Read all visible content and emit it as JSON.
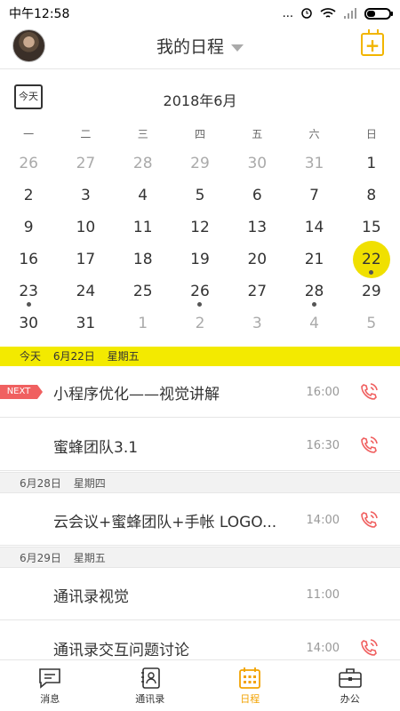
{
  "status": {
    "time": "中午12:58",
    "signal_text": "...",
    "battery_level": 0.35
  },
  "header": {
    "title": "我的日程"
  },
  "calendar": {
    "today_label": "今天",
    "month": "2018年6月",
    "weekdays": [
      "一",
      "二",
      "三",
      "四",
      "五",
      "六",
      "日"
    ],
    "rows": [
      [
        {
          "d": "26",
          "m": true
        },
        {
          "d": "27",
          "m": true
        },
        {
          "d": "28",
          "m": true
        },
        {
          "d": "29",
          "m": true
        },
        {
          "d": "30",
          "m": true
        },
        {
          "d": "31",
          "m": true
        },
        {
          "d": "1"
        }
      ],
      [
        {
          "d": "2"
        },
        {
          "d": "3"
        },
        {
          "d": "4"
        },
        {
          "d": "5"
        },
        {
          "d": "6"
        },
        {
          "d": "7"
        },
        {
          "d": "8"
        }
      ],
      [
        {
          "d": "9"
        },
        {
          "d": "10"
        },
        {
          "d": "11"
        },
        {
          "d": "12"
        },
        {
          "d": "13"
        },
        {
          "d": "14"
        },
        {
          "d": "15"
        }
      ],
      [
        {
          "d": "16"
        },
        {
          "d": "17"
        },
        {
          "d": "18"
        },
        {
          "d": "19"
        },
        {
          "d": "20"
        },
        {
          "d": "21"
        },
        {
          "d": "22",
          "sel": true,
          "dot": true
        }
      ],
      [
        {
          "d": "23",
          "dot": true
        },
        {
          "d": "24"
        },
        {
          "d": "25"
        },
        {
          "d": "26",
          "dot": true
        },
        {
          "d": "27"
        },
        {
          "d": "28",
          "dot": true
        },
        {
          "d": "29"
        }
      ],
      [
        {
          "d": "30"
        },
        {
          "d": "31"
        },
        {
          "d": "1",
          "m": true
        },
        {
          "d": "2",
          "m": true
        },
        {
          "d": "3",
          "m": true
        },
        {
          "d": "4",
          "m": true
        },
        {
          "d": "5",
          "m": true
        }
      ]
    ]
  },
  "agenda": {
    "today_bar": {
      "label": "今天",
      "date": "6月22日",
      "weekday": "星期五"
    },
    "next_badge": "NEXT",
    "items": [
      {
        "title": "小程序优化——视觉讲解",
        "time": "16:00",
        "phone": true
      },
      {
        "title": "蜜蜂团队3.1",
        "time": "16:30",
        "phone": true
      },
      {
        "title": "云会议+蜜蜂团队+手帐 LOGO...",
        "time": "14:00",
        "phone": true
      },
      {
        "title": "通讯录视觉",
        "time": "11:00",
        "phone": false
      },
      {
        "title": "通讯录交互问题讨论",
        "time": "14:00",
        "phone": true
      }
    ],
    "sections": [
      {
        "date": "6月28日",
        "weekday": "星期四"
      },
      {
        "date": "6月29日",
        "weekday": "星期五"
      }
    ]
  },
  "nav": {
    "tabs": [
      {
        "label": "消息",
        "icon": "message-icon"
      },
      {
        "label": "通讯录",
        "icon": "contacts-icon"
      },
      {
        "label": "日程",
        "icon": "calendar-icon",
        "active": true
      },
      {
        "label": "办公",
        "icon": "briefcase-icon"
      }
    ]
  },
  "colors": {
    "accent_yellow": "#f3ea00",
    "brand_orange": "#f2a200",
    "phone_red": "#f06060"
  }
}
